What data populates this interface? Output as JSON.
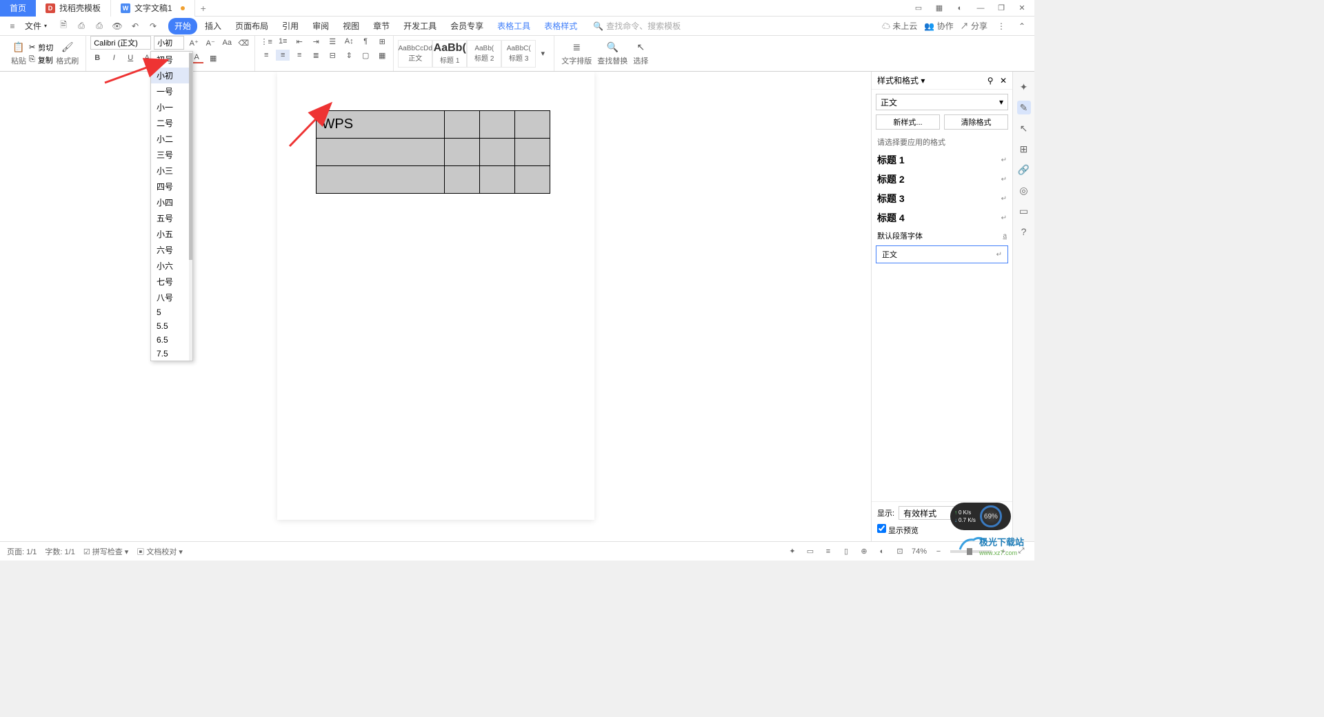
{
  "title_tabs": {
    "home": "首页",
    "template": "找稻壳模板",
    "doc": "文字文稿1",
    "plus": "+"
  },
  "window_controls": {
    "min": "—",
    "restore": "❐",
    "close": "✕"
  },
  "menubar": {
    "file": "文件",
    "items": [
      "开始",
      "插入",
      "页面布局",
      "引用",
      "审阅",
      "视图",
      "章节",
      "开发工具",
      "会员专享",
      "表格工具",
      "表格样式"
    ],
    "search_placeholder": "查找命令、搜索模板",
    "right": {
      "cloud": "未上云",
      "coop": "协作",
      "share": "分享"
    }
  },
  "toolbar": {
    "paste": "粘贴",
    "cut": "剪切",
    "copy": "复制",
    "format_painter": "格式刷",
    "font_name": "Calibri (正文)",
    "font_size": "小初",
    "styles": {
      "body": {
        "preview": "AaBbCcDd",
        "label": "正文"
      },
      "h1": {
        "preview": "AaBb(",
        "label": "标题 1"
      },
      "h2": {
        "preview": "AaBb(",
        "label": "标题 2"
      },
      "h3": {
        "preview": "AaBbC(",
        "label": "标题 3"
      }
    },
    "text_layout": "文字排版",
    "find_replace": "查找替换",
    "select": "选择"
  },
  "font_sizes": [
    "初号",
    "小初",
    "一号",
    "小一",
    "二号",
    "小二",
    "三号",
    "小三",
    "四号",
    "小四",
    "五号",
    "小五",
    "六号",
    "小六",
    "七号",
    "八号",
    "5",
    "5.5",
    "6.5",
    "7.5"
  ],
  "document": {
    "cell_text": "WPS"
  },
  "right_panel": {
    "title": "样式和格式",
    "current": "正文",
    "new_style": "新样式...",
    "clear_format": "清除格式",
    "prompt": "请选择要应用的格式",
    "styles": [
      "标题 1",
      "标题 2",
      "标题 3",
      "标题 4"
    ],
    "default_font": "默认段落字体",
    "body_style": "正文",
    "show_label": "显示:",
    "show_value": "有效样式",
    "preview_check": "显示预览"
  },
  "statusbar": {
    "page": "页面: 1/1",
    "words": "字数: 1/1",
    "spell": "拼写检查",
    "content": "文档校对",
    "zoom": "74%"
  },
  "gauge": {
    "up": "0 K/s",
    "down": "0.7 K/s",
    "pct": "69%"
  },
  "dl_site": {
    "name": "极光下载站",
    "url": "www.xz7.com"
  }
}
